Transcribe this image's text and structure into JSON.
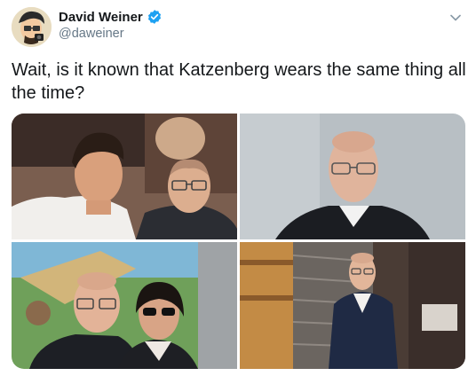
{
  "user": {
    "display_name": "David Weiner",
    "handle": "@daweiner",
    "verified": true,
    "avatar_icon": "avatar-illustration"
  },
  "tweet": {
    "text": "Wait, is it known that Katzenberg wears the same thing all the time?"
  },
  "media": {
    "count": 4,
    "photos": [
      {
        "label": "photo-1"
      },
      {
        "label": "photo-2"
      },
      {
        "label": "photo-3"
      },
      {
        "label": "photo-4"
      }
    ]
  },
  "icons": {
    "verified": "verified-badge-icon",
    "menu": "chevron-down-icon"
  },
  "colors": {
    "verified_blue": "#1da1f2",
    "text_primary": "#14171a",
    "text_secondary": "#657786"
  }
}
